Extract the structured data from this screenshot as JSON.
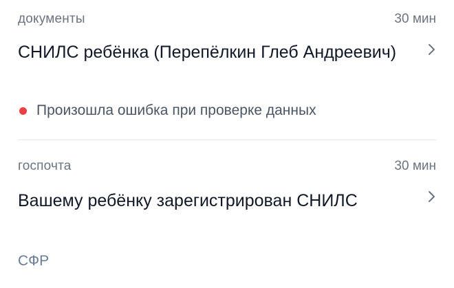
{
  "notifications": [
    {
      "category": "документы",
      "time": "30 мин",
      "title": "СНИЛС ребёнка (Перепёлкин Глеб Андреевич)",
      "status": {
        "text": "Произошла ошибка при проверке данных",
        "color": "#ee3f44"
      }
    },
    {
      "category": "госпочта",
      "time": "30 мин",
      "title": "Вашему ребёнку зарегистрирован СНИЛС",
      "sender": "СФР"
    }
  ]
}
